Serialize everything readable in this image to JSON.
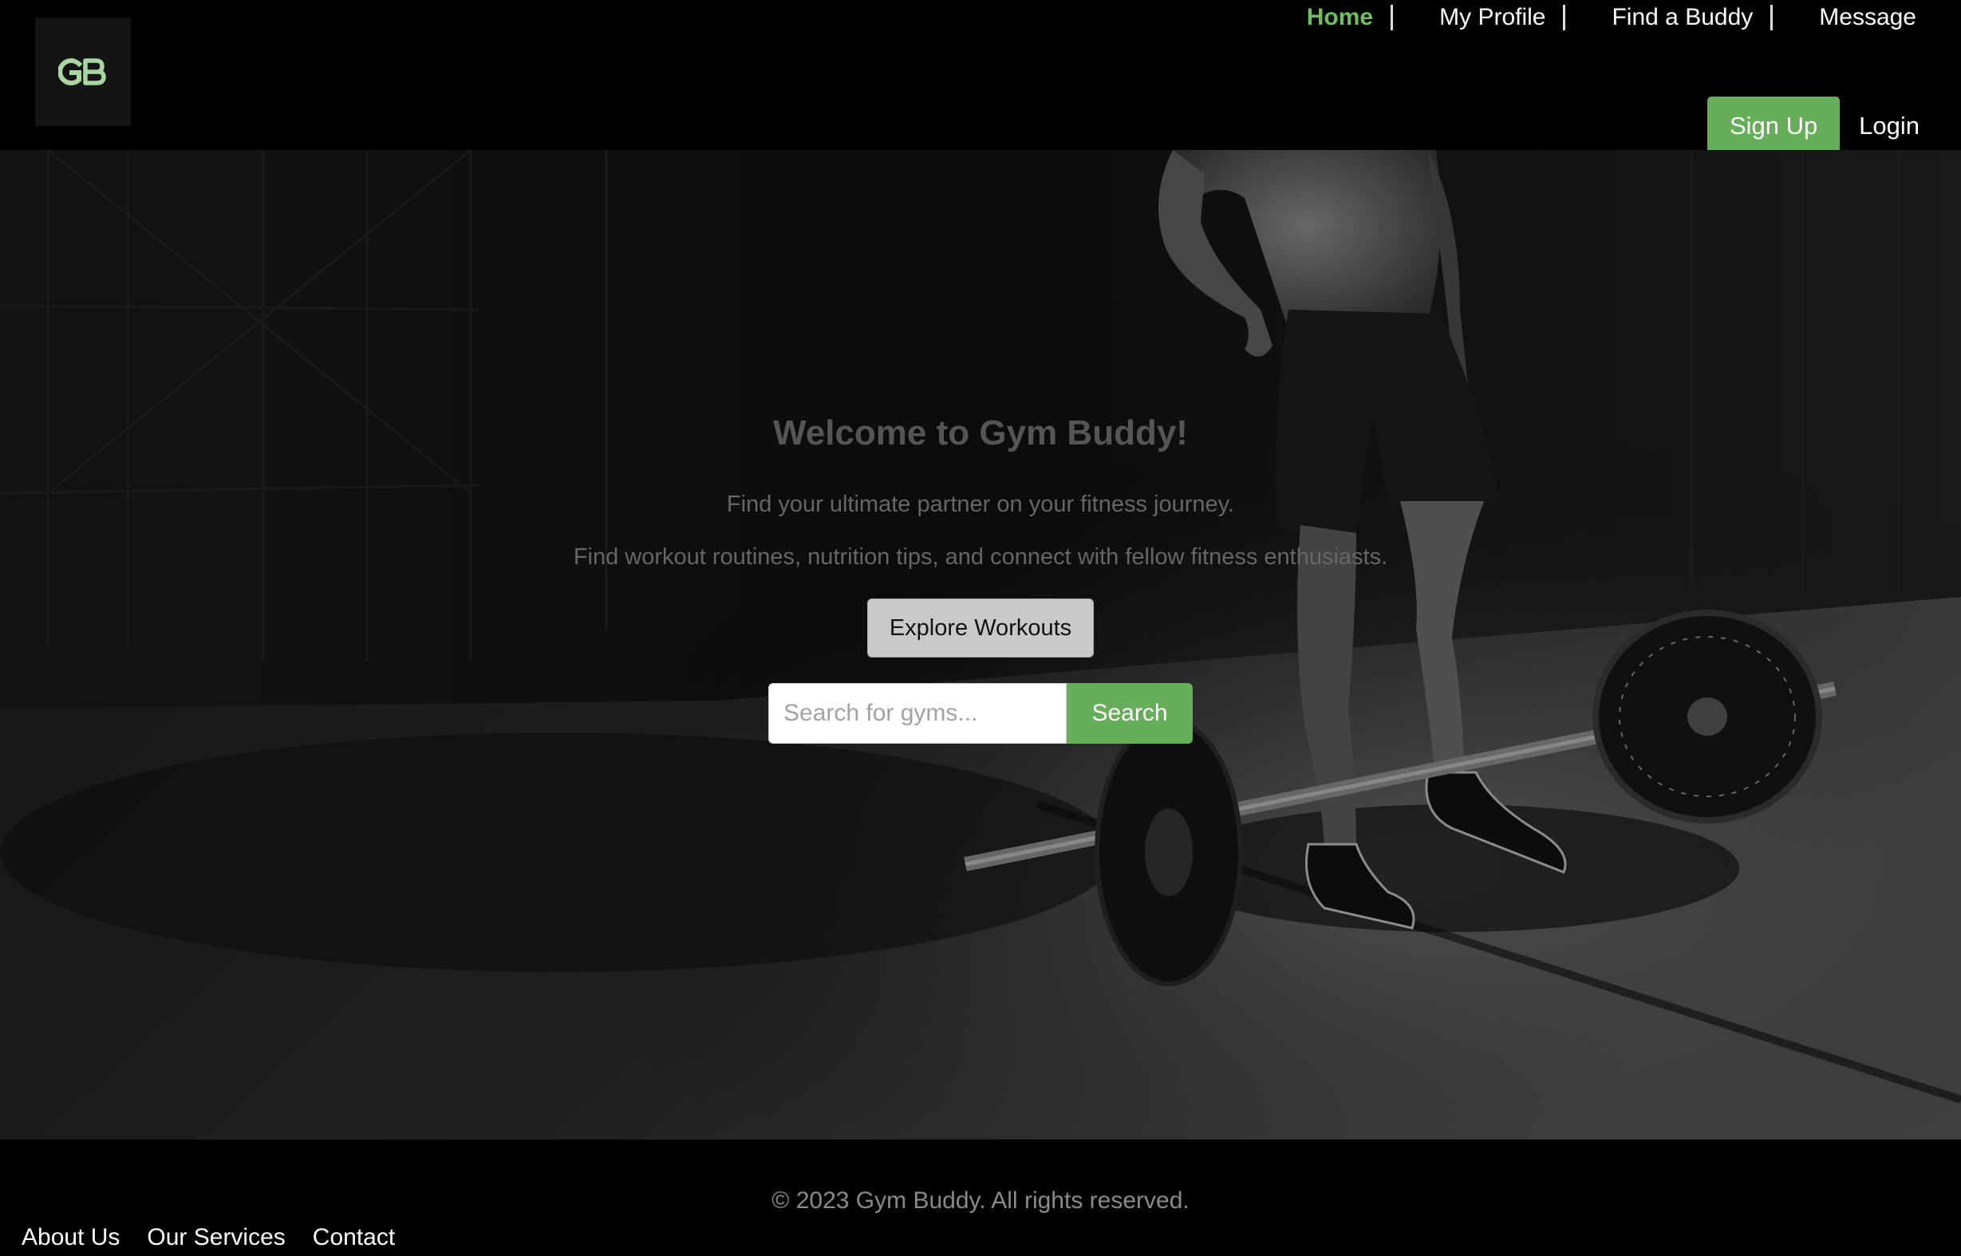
{
  "brand": {
    "logo_text": "GB",
    "logo_color": "#a8d5a0"
  },
  "nav": {
    "items": [
      {
        "label": "Home",
        "active": true
      },
      {
        "label": "My Profile",
        "active": false
      },
      {
        "label": "Find a Buddy",
        "active": false
      },
      {
        "label": "Message",
        "active": false
      }
    ]
  },
  "auth": {
    "signup_label": "Sign Up",
    "login_label": "Login"
  },
  "hero": {
    "title": "Welcome to Gym Buddy!",
    "subtitle_1": "Find your ultimate partner on your fitness journey.",
    "subtitle_2": "Find workout routines, nutrition tips, and connect with fellow fitness enthusiasts.",
    "explore_label": "Explore Workouts",
    "background_image": "black-and-white photo of athlete standing beside a loaded barbell"
  },
  "search": {
    "placeholder": "Search for gyms...",
    "value": "",
    "button_label": "Search"
  },
  "footer": {
    "copyright": "© 2023 Gym Buddy. All rights reserved.",
    "links": [
      {
        "label": "About Us"
      },
      {
        "label": "Our Services"
      },
      {
        "label": "Contact"
      }
    ]
  },
  "colors": {
    "accent": "#66ae5a",
    "active_nav": "#6fbf60",
    "background": "#000000"
  }
}
